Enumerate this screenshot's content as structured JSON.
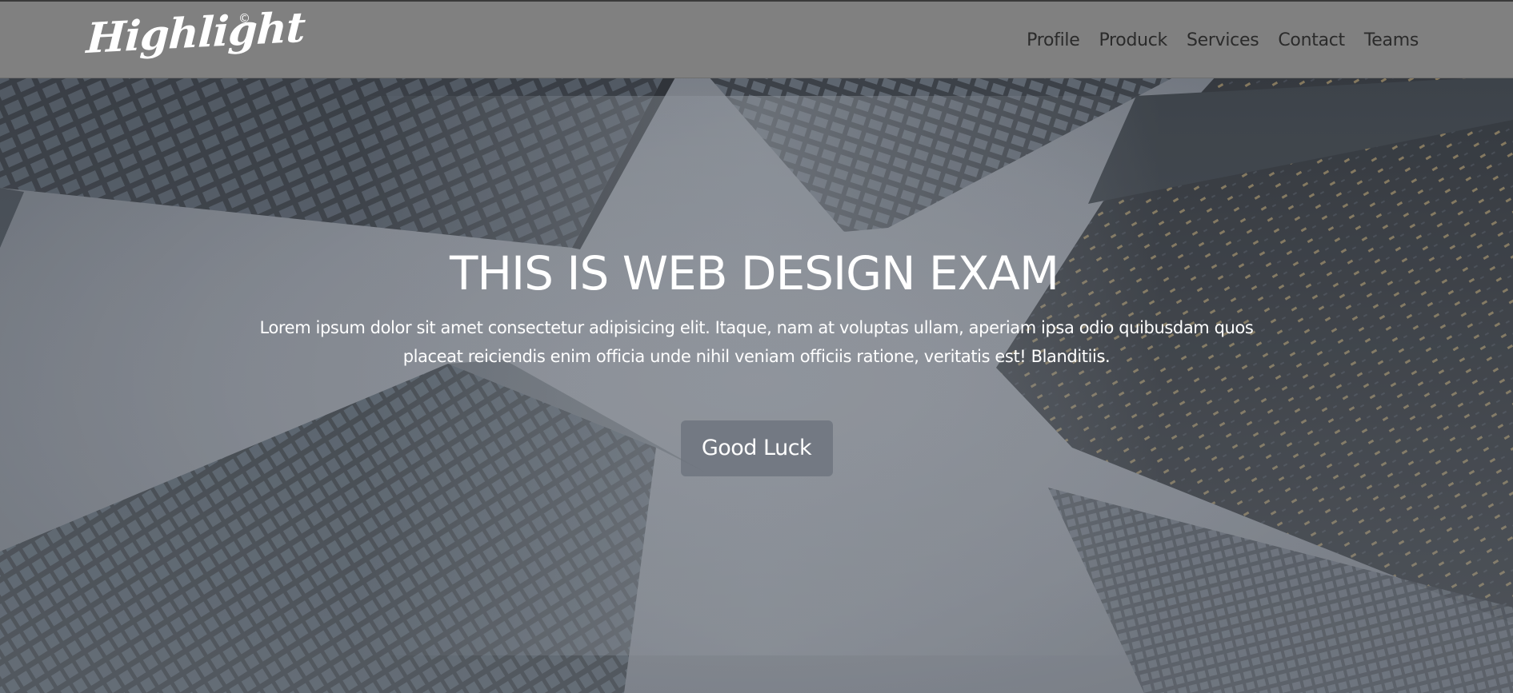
{
  "brand": {
    "name": "Highlight",
    "mark": "©"
  },
  "nav": {
    "items": [
      "Profile",
      "Produck",
      "Services",
      "Contact",
      "Teams"
    ]
  },
  "hero": {
    "title": "THIS IS WEB DESIGN EXAM",
    "text": "Lorem ipsum dolor sit amet consectetur adipisicing elit. Itaque, nam at voluptas ullam, aperiam ipsa odio quibusdam quos placeat reiciendis enim officia unde nihil veniam officiis ratione, veritatis est! Blanditiis.",
    "button_label": "Good Luck"
  },
  "colors": {
    "navbar": "#808080",
    "nav_link": "#2b2b2b",
    "hero_text": "#ffffff",
    "button_bg": "#6c727c"
  }
}
